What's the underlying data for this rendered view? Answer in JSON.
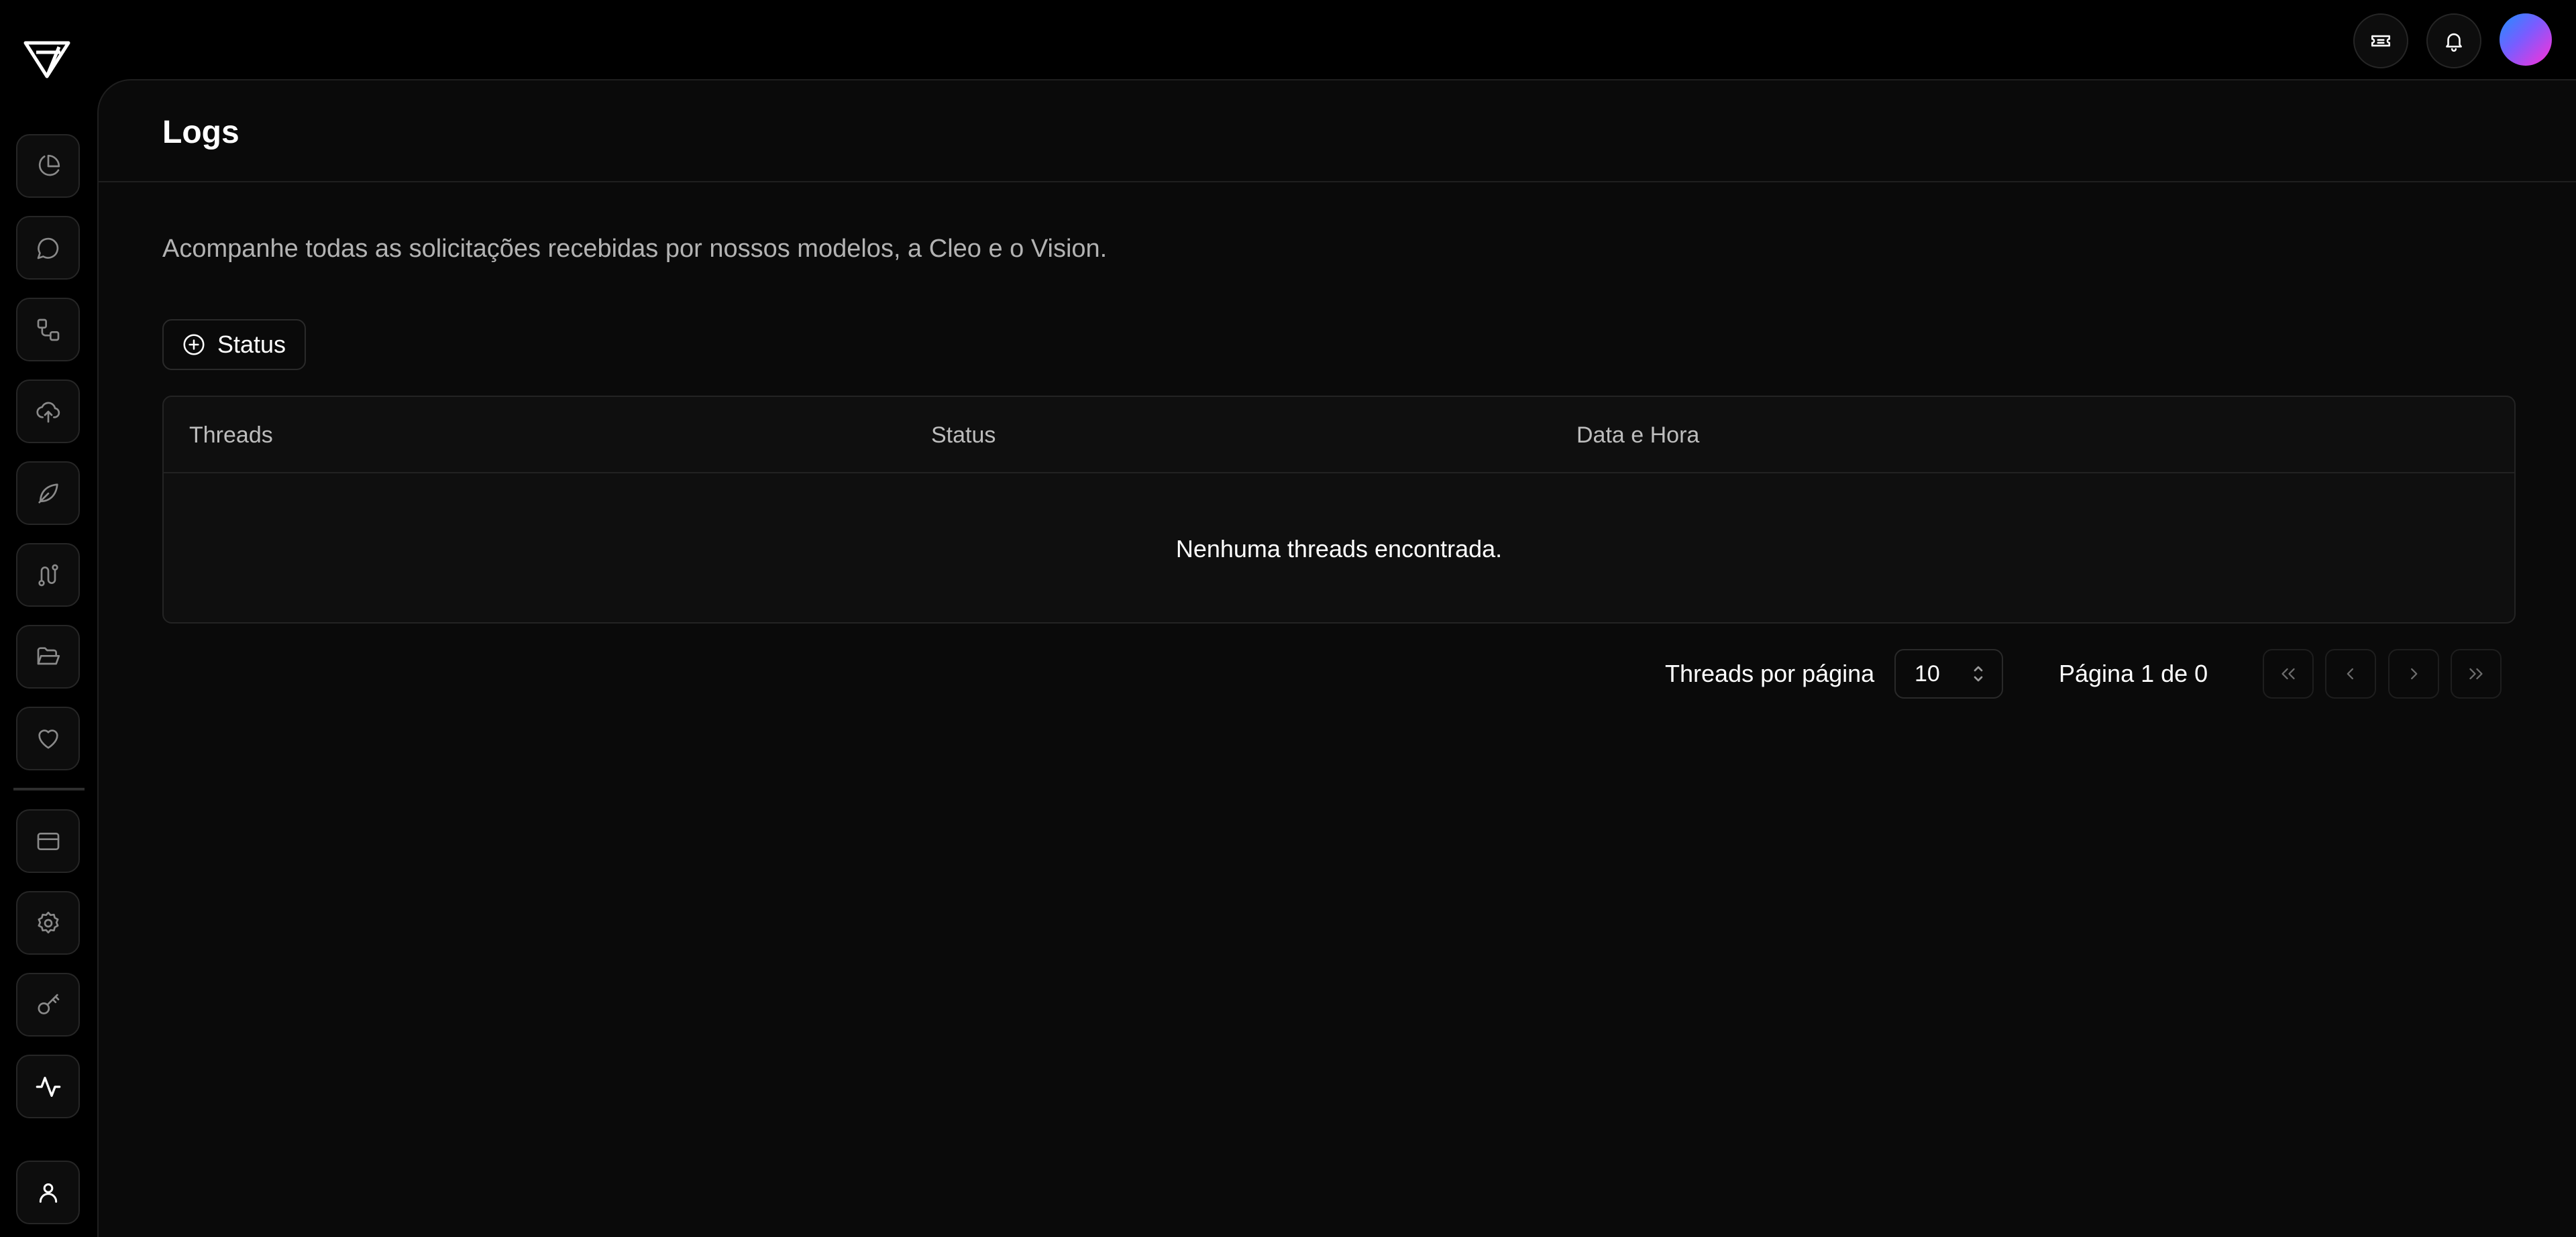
{
  "header": {
    "title": "Logs",
    "icons": [
      "ticket-icon",
      "bell-icon"
    ]
  },
  "sidebar": {
    "items": [
      {
        "icon": "pie-chart-icon",
        "active": false
      },
      {
        "icon": "chat-bubble-icon",
        "active": false
      },
      {
        "icon": "workflow-icon",
        "active": false
      },
      {
        "icon": "cloud-upload-icon",
        "active": false
      },
      {
        "icon": "leaf-icon",
        "active": false
      },
      {
        "icon": "route-icon",
        "active": false
      },
      {
        "icon": "folder-open-icon",
        "active": false
      },
      {
        "icon": "heart-icon",
        "active": false
      },
      {
        "icon": "credit-card-icon",
        "active": false
      },
      {
        "icon": "gear-icon",
        "active": false
      },
      {
        "icon": "key-icon",
        "active": false
      },
      {
        "icon": "activity-icon",
        "active": true
      },
      {
        "icon": "user-icon",
        "active": false
      }
    ]
  },
  "main": {
    "description": "Acompanhe todas as solicitações recebidas por nossos modelos, a Cleo e o Vision.",
    "filter_label": "Status",
    "table": {
      "columns": [
        "Threads",
        "Status",
        "Data e Hora"
      ],
      "empty_message": "Nenhuma threads encontrada."
    },
    "pagination": {
      "per_page_label": "Threads por página",
      "page_size": "10",
      "page_info": "Página 1 de 0"
    }
  },
  "colors": {
    "background": "#000000",
    "panel": "#0a0a0a",
    "border": "#262626",
    "text": "#ffffff",
    "muted_text": "#b3b3b3"
  }
}
